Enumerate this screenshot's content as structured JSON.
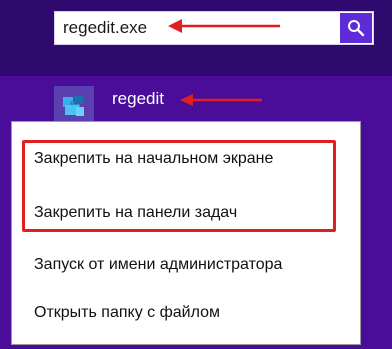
{
  "search": {
    "value": "regedit.exe",
    "button_icon": "search-icon"
  },
  "result": {
    "label": "regedit",
    "icon": "registry-editor-icon"
  },
  "context_menu": {
    "items": [
      {
        "label": "Закрепить на начальном экране"
      },
      {
        "label": "Закрепить на панели задач"
      },
      {
        "label": "Запуск от имени администратора"
      },
      {
        "label": "Открыть папку с файлом"
      }
    ]
  },
  "colors": {
    "background": "#4a0d9a",
    "top_band": "#2f0a6e",
    "search_button": "#5f2bd9",
    "annotation_red": "#e02020"
  }
}
